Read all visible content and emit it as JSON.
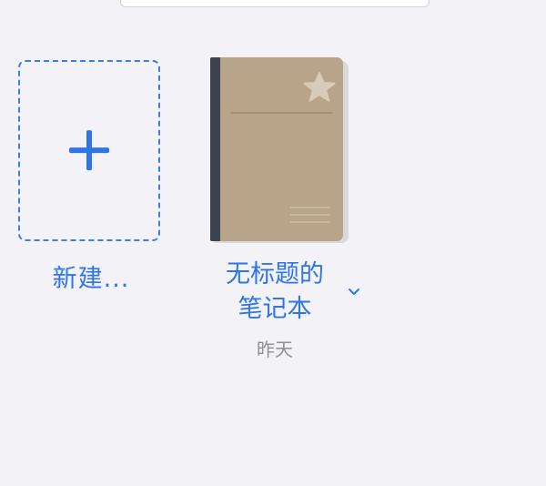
{
  "new_tile": {
    "label": "新建...",
    "icon": "plus-icon"
  },
  "notebook": {
    "title_line1": "无标题的",
    "title_line2": "笔记本",
    "date": "昨天",
    "cover_icon": "star-icon",
    "menu_icon": "chevron-down-icon"
  },
  "colors": {
    "accent": "#2f75e6",
    "background": "#f2f2f7",
    "cover": "#b8a488",
    "spine": "#3e4350",
    "muted_text": "#8e8e93"
  }
}
